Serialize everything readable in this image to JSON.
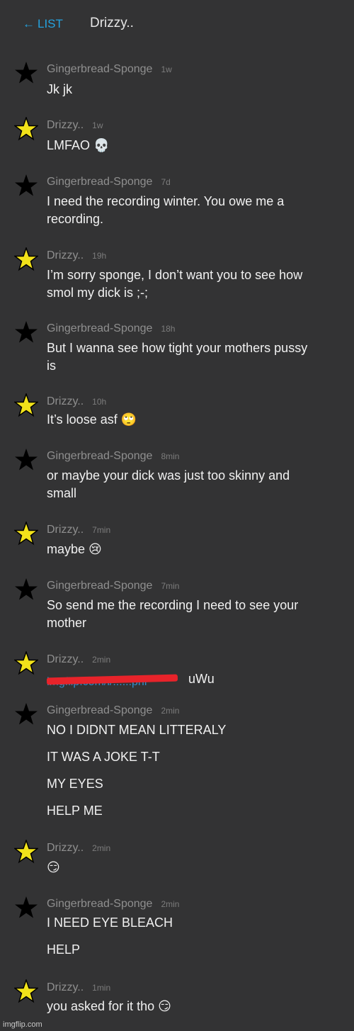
{
  "header": {
    "back_arrow": "←",
    "back_label": "LIST",
    "title": "Drizzy.."
  },
  "colors": {
    "background": "#333334",
    "link": "#25a3df",
    "star_black": "#000000",
    "star_yellow": "#f2e21a",
    "redaction": "#e8232a"
  },
  "messages": [
    {
      "author": "Gingerbread-Sponge",
      "time": "1w",
      "lines": [
        "Jk jk"
      ]
    },
    {
      "author": "Drizzy..",
      "time": "1w",
      "lines": [
        "LMFAO 💀"
      ]
    },
    {
      "author": "Gingerbread-Sponge",
      "time": "7d",
      "lines": [
        "I need the recording winter. You owe me a",
        "recording."
      ]
    },
    {
      "author": "Drizzy..",
      "time": "19h",
      "lines": [
        "I’m sorry sponge, I don’t want you to see how",
        "smol my dick is ;-;"
      ]
    },
    {
      "author": "Gingerbread-Sponge",
      "time": "18h",
      "lines": [
        "But I wanna see how tight your mothers pussy",
        "is"
      ]
    },
    {
      "author": "Drizzy..",
      "time": "10h",
      "lines": [
        "It’s loose asf 🙄"
      ]
    },
    {
      "author": "Gingerbread-Sponge",
      "time": "8min",
      "lines": [
        "or maybe your dick was just too skinny and",
        "small"
      ]
    },
    {
      "author": "Drizzy..",
      "time": "7min",
      "lines": [
        "maybe 😢"
      ]
    },
    {
      "author": "Gingerbread-Sponge",
      "time": "7min",
      "lines": [
        "So send me the recording I need to see your",
        "mother"
      ]
    },
    {
      "author": "Drizzy..",
      "time": "2min",
      "link_text": "imgflip.com/i/......phi",
      "after_link": "uWu"
    },
    {
      "author": "Gingerbread-Sponge",
      "time": "2min",
      "lines": [
        "NO I DIDNT MEAN LITTERALY",
        "IT WAS A JOKE T-T",
        "MY EYES",
        "HELP ME"
      ]
    },
    {
      "author": "Drizzy..",
      "time": "2min",
      "lines": [
        "😏"
      ]
    },
    {
      "author": "Gingerbread-Sponge",
      "time": "2min",
      "lines": [
        "I NEED EYE BLEACH",
        "HELP"
      ]
    },
    {
      "author": "Drizzy..",
      "time": "1min",
      "lines": [
        "you asked for it tho 😏"
      ]
    }
  ],
  "watermark": "imgflip.com"
}
